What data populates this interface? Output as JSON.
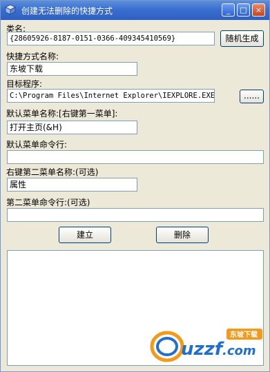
{
  "window": {
    "title": "创建无法删除的快捷方式",
    "icon": "cube-icon"
  },
  "caption_buttons": {
    "minimize": "_",
    "maximize": "□",
    "close": "×"
  },
  "class_name": {
    "label": "类名:",
    "value": "{28605926-8187-0151-0366-409345410569}",
    "generate_button": "随机生成"
  },
  "shortcut_name": {
    "label": "快捷方式名称:",
    "value": "东坡下载"
  },
  "target": {
    "label": "目标程序:",
    "value": "C:\\Program Files\\Internet Explorer\\IEXPLORE.EXE",
    "browse_button": "......"
  },
  "default_menu_name": {
    "label": "默认菜单名称:[右键第一菜单]:",
    "value": "打开主页(&H)"
  },
  "default_menu_cmd": {
    "label": "默认菜单命令行:",
    "value": ""
  },
  "second_menu_name": {
    "label": "右键第二菜单名称:(可选)",
    "value": "属性"
  },
  "second_menu_cmd": {
    "label": "第二菜单命令行:(可选)",
    "value": ""
  },
  "actions": {
    "create": "建立",
    "delete": "删除"
  },
  "output": {
    "value": ""
  },
  "watermark": {
    "logo": "uzzf.com",
    "tag": "东坡下载"
  },
  "colors": {
    "titlebar": "#2c5fc4",
    "window_bg": "#ece9d8",
    "field_border": "#7f9db9",
    "button_border": "#003c74"
  }
}
